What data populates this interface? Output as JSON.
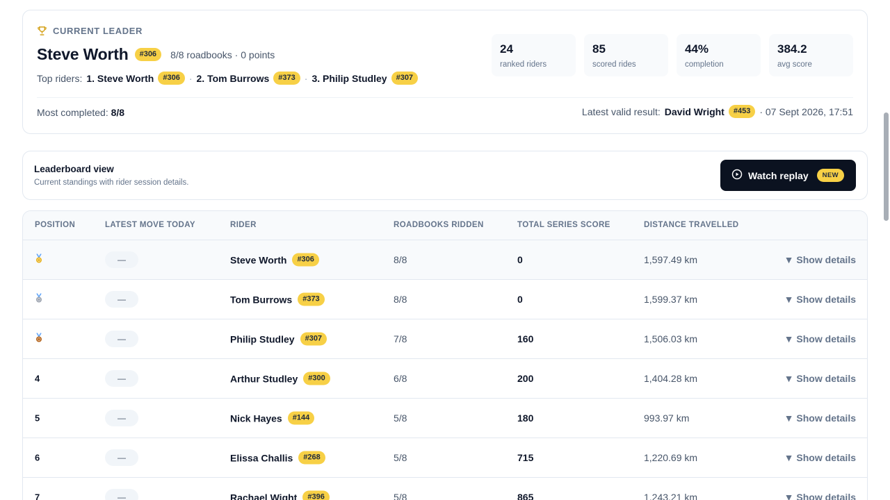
{
  "leader": {
    "tag": "CURRENT LEADER",
    "name": "Steve Worth",
    "bib": "#306",
    "meta": "8/8 roadbooks · 0 points",
    "top_riders_label": "Top riders:",
    "top_riders": [
      {
        "label": "1. Steve Worth",
        "bib": "#306"
      },
      {
        "label": "2. Tom Burrows",
        "bib": "#373"
      },
      {
        "label": "3. Philip Studley",
        "bib": "#307"
      }
    ],
    "most_completed_label": "Most completed:",
    "most_completed_value": "8/8",
    "latest_label": "Latest valid result:",
    "latest_name": "David Wright",
    "latest_bib": "#453",
    "latest_time": "· 07 Sept 2026, 17:51"
  },
  "stats": [
    {
      "value": "24",
      "label": "ranked riders"
    },
    {
      "value": "85",
      "label": "scored rides"
    },
    {
      "value": "44%",
      "label": "completion"
    },
    {
      "value": "384.2",
      "label": "avg score"
    }
  ],
  "view": {
    "title": "Leaderboard view",
    "subtitle": "Current standings with rider session details.",
    "replay_label": "Watch replay",
    "new_badge": "NEW"
  },
  "table": {
    "headers": [
      "POSITION",
      "LATEST MOVE TODAY",
      "RIDER",
      "ROADBOOKS RIDDEN",
      "TOTAL SERIES SCORE",
      "DISTANCE TRAVELLED"
    ],
    "rows": [
      {
        "position": "",
        "medal": "gold",
        "move": "—",
        "rider": "Steve Worth",
        "bib": "#306",
        "roadbooks": "8/8",
        "score": "0",
        "distance": "1,597.49 km",
        "details": "▼ Show details"
      },
      {
        "position": "",
        "medal": "silver",
        "move": "—",
        "rider": "Tom Burrows",
        "bib": "#373",
        "roadbooks": "8/8",
        "score": "0",
        "distance": "1,599.37 km",
        "details": "▼ Show details"
      },
      {
        "position": "",
        "medal": "bronze",
        "move": "—",
        "rider": "Philip Studley",
        "bib": "#307",
        "roadbooks": "7/8",
        "score": "160",
        "distance": "1,506.03 km",
        "details": "▼ Show details"
      },
      {
        "position": "4",
        "medal": "",
        "move": "—",
        "rider": "Arthur Studley",
        "bib": "#300",
        "roadbooks": "6/8",
        "score": "200",
        "distance": "1,404.28 km",
        "details": "▼ Show details"
      },
      {
        "position": "5",
        "medal": "",
        "move": "—",
        "rider": "Nick Hayes",
        "bib": "#144",
        "roadbooks": "5/8",
        "score": "180",
        "distance": "993.97 km",
        "details": "▼ Show details"
      },
      {
        "position": "6",
        "medal": "",
        "move": "—",
        "rider": "Elissa Challis",
        "bib": "#268",
        "roadbooks": "5/8",
        "score": "715",
        "distance": "1,220.69 km",
        "details": "▼ Show details"
      },
      {
        "position": "7",
        "medal": "",
        "move": "—",
        "rider": "Rachael Wight",
        "bib": "#396",
        "roadbooks": "5/8",
        "score": "865",
        "distance": "1,243.21 km",
        "details": "▼ Show details"
      }
    ]
  },
  "colors": {
    "accent": "#f7d046",
    "dark_button": "#0b1220",
    "gold": "#e8b21e",
    "silver": "#9ca3af",
    "bronze": "#b5651d"
  }
}
